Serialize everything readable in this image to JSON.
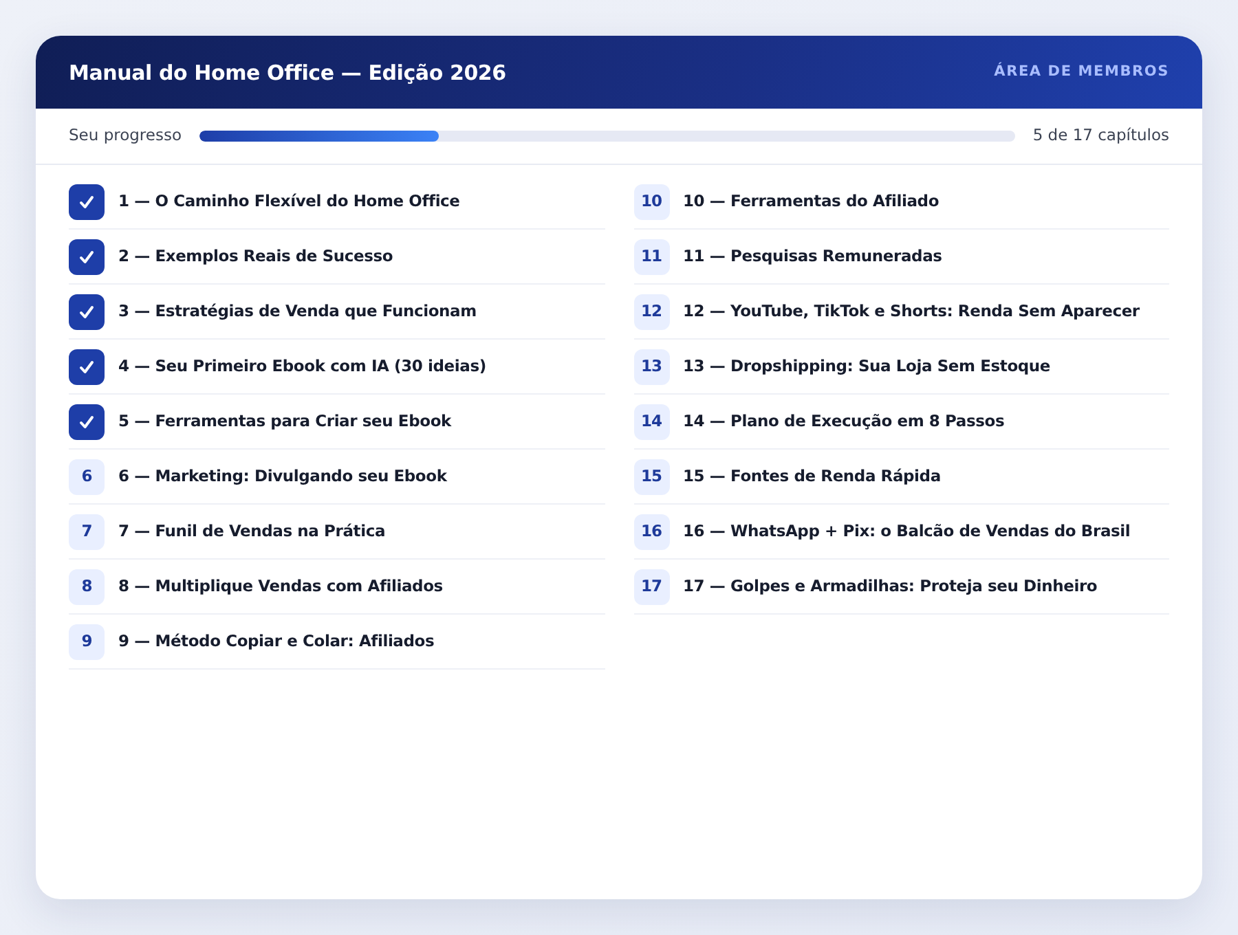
{
  "header": {
    "title": "Manual do Home Office — Edição 2026",
    "link": "ÁREA DE MEMBROS"
  },
  "progress": {
    "label": "Seu progresso",
    "level": 0.294,
    "reading": "5 de 17 capítulos"
  },
  "chapters": [
    {
      "title": "1 — O Caminho Flexível do Home Office",
      "done": true
    },
    {
      "title": "2 — Exemplos Reais de Sucesso",
      "done": true
    },
    {
      "title": "3 — Estratégias de Venda que Funcionam",
      "done": true
    },
    {
      "title": "4 — Seu Primeiro Ebook com IA (30 ideias)",
      "done": true
    },
    {
      "title": "5 — Ferramentas para Criar seu Ebook",
      "done": true
    },
    {
      "badge": "6",
      "title": "6 — Marketing: Divulgando seu Ebook",
      "done": false
    },
    {
      "badge": "7",
      "title": "7 — Funil de Vendas na Prática",
      "done": false
    },
    {
      "badge": "8",
      "title": "8 — Multiplique Vendas com Afiliados",
      "done": false
    },
    {
      "badge": "9",
      "title": "9 — Método Copiar e Colar: Afiliados",
      "done": false
    },
    {
      "badge": "10",
      "title": "10 — Ferramentas do Afiliado",
      "done": false
    },
    {
      "badge": "11",
      "title": "11 — Pesquisas Remuneradas",
      "done": false
    },
    {
      "badge": "12",
      "title": "12 — YouTube, TikTok e Shorts: Renda Sem Aparecer",
      "done": false
    },
    {
      "badge": "13",
      "title": "13 — Dropshipping: Sua Loja Sem Estoque",
      "done": false
    },
    {
      "badge": "14",
      "title": "14 — Plano de Execução em 8 Passos",
      "done": false
    },
    {
      "badge": "15",
      "title": "15 — Fontes de Renda Rápida",
      "done": false
    },
    {
      "badge": "16",
      "title": "16 — WhatsApp + Pix: o Balcão de Vendas do Brasil",
      "done": false
    },
    {
      "badge": "17",
      "title": "17 — Golpes e Armadilhas: Proteja seu Dinheiro",
      "done": false
    }
  ]
}
